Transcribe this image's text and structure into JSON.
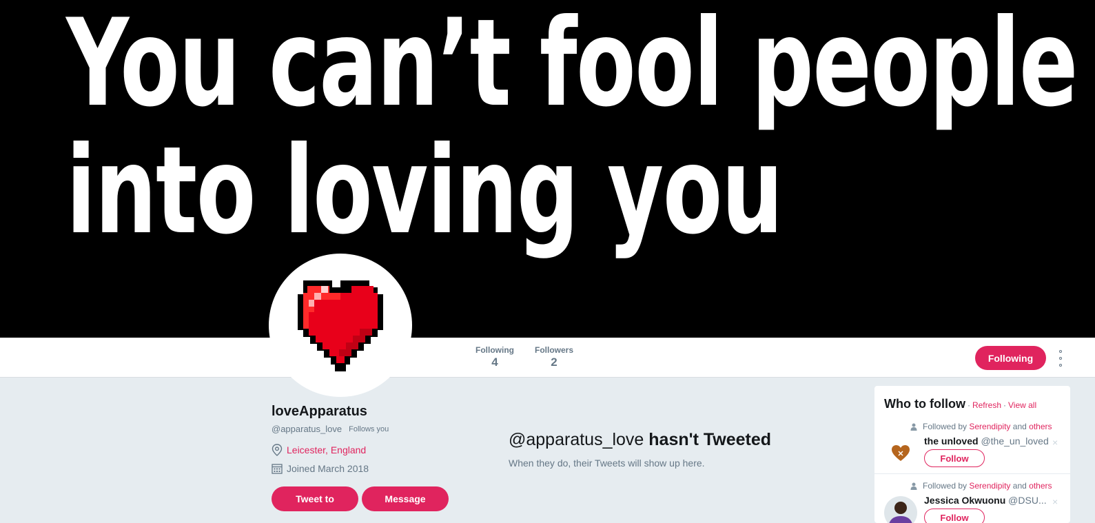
{
  "banner": {
    "line1": "You can’t fool people",
    "line2": "into loving you"
  },
  "stats": {
    "following_label": "Following",
    "following_count": "4",
    "followers_label": "Followers",
    "followers_count": "2"
  },
  "actions": {
    "following_button": "Following",
    "more_icon": "more-vertical-icon"
  },
  "profile": {
    "name": "loveApparatus",
    "handle": "@apparatus_love",
    "follows_you": "Follows you",
    "location": "Leicester, England",
    "joined": "Joined March 2018",
    "tweet_to": "Tweet to",
    "message": "Message"
  },
  "timeline": {
    "handle": "@apparatus_love",
    "title_rest": " hasn't Tweeted",
    "subtitle": "When they do, their Tweets will show up here."
  },
  "who_to_follow": {
    "title": "Who to follow",
    "sep1": "·",
    "refresh": "Refresh",
    "sep2": "·",
    "view_all": "View all",
    "items": [
      {
        "followed_by": "Followed by",
        "friend": "Serendipity",
        "and": "and",
        "others": "others",
        "name": "the unloved",
        "handle": "@the_un_loved",
        "follow": "Follow",
        "close": "×"
      },
      {
        "followed_by": "Followed by",
        "friend": "Serendipity",
        "and": "and",
        "others": "others",
        "name": "Jessica Okwuonu",
        "handle": "@DSU...",
        "follow": "Follow",
        "close": "×"
      }
    ]
  },
  "colors": {
    "accent": "#e0245e",
    "background": "#e6ecf0",
    "muted": "#657786"
  }
}
